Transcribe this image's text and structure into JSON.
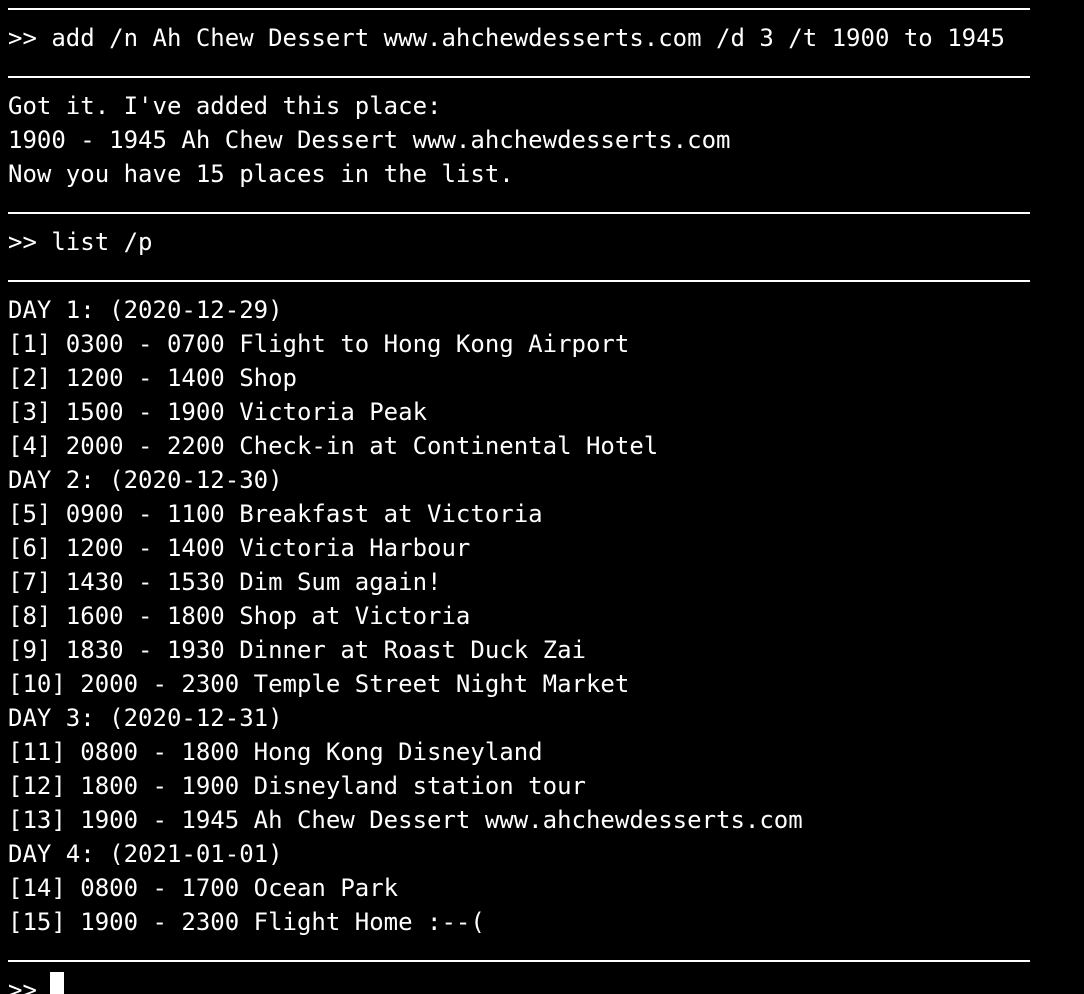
{
  "terminal": {
    "lines": [
      ">> add /n Ah Chew Dessert www.ahchewdesserts.com /d 3 /t 1900 to 1945",
      "Got it. I've added this place:",
      "1900 - 1945 Ah Chew Dessert www.ahchewdesserts.com",
      "Now you have 15 places in the list.",
      ">> list /p",
      "DAY 1: (2020-12-29)",
      "[1] 0300 - 0700 Flight to Hong Kong Airport",
      "[2] 1200 - 1400 Shop",
      "[3] 1500 - 1900 Victoria Peak",
      "[4] 2000 - 2200 Check-in at Continental Hotel",
      "DAY 2: (2020-12-30)",
      "[5] 0900 - 1100 Breakfast at Victoria",
      "[6] 1200 - 1400 Victoria Harbour",
      "[7] 1430 - 1530 Dim Sum again!",
      "[8] 1600 - 1800 Shop at Victoria",
      "[9] 1830 - 1930 Dinner at Roast Duck Zai",
      "[10] 2000 - 2300 Temple Street Night Market",
      "DAY 3: (2020-12-31)",
      "[11] 0800 - 1800 Hong Kong Disneyland",
      "[12] 1800 - 1900 Disneyland station tour",
      "[13] 1900 - 1945 Ah Chew Dessert www.ahchewdesserts.com",
      "DAY 4: (2021-01-01)",
      "[14] 0800 - 1700 Ocean Park",
      "[15] 1900 - 2300 Flight Home :--(",
      ">>"
    ]
  }
}
